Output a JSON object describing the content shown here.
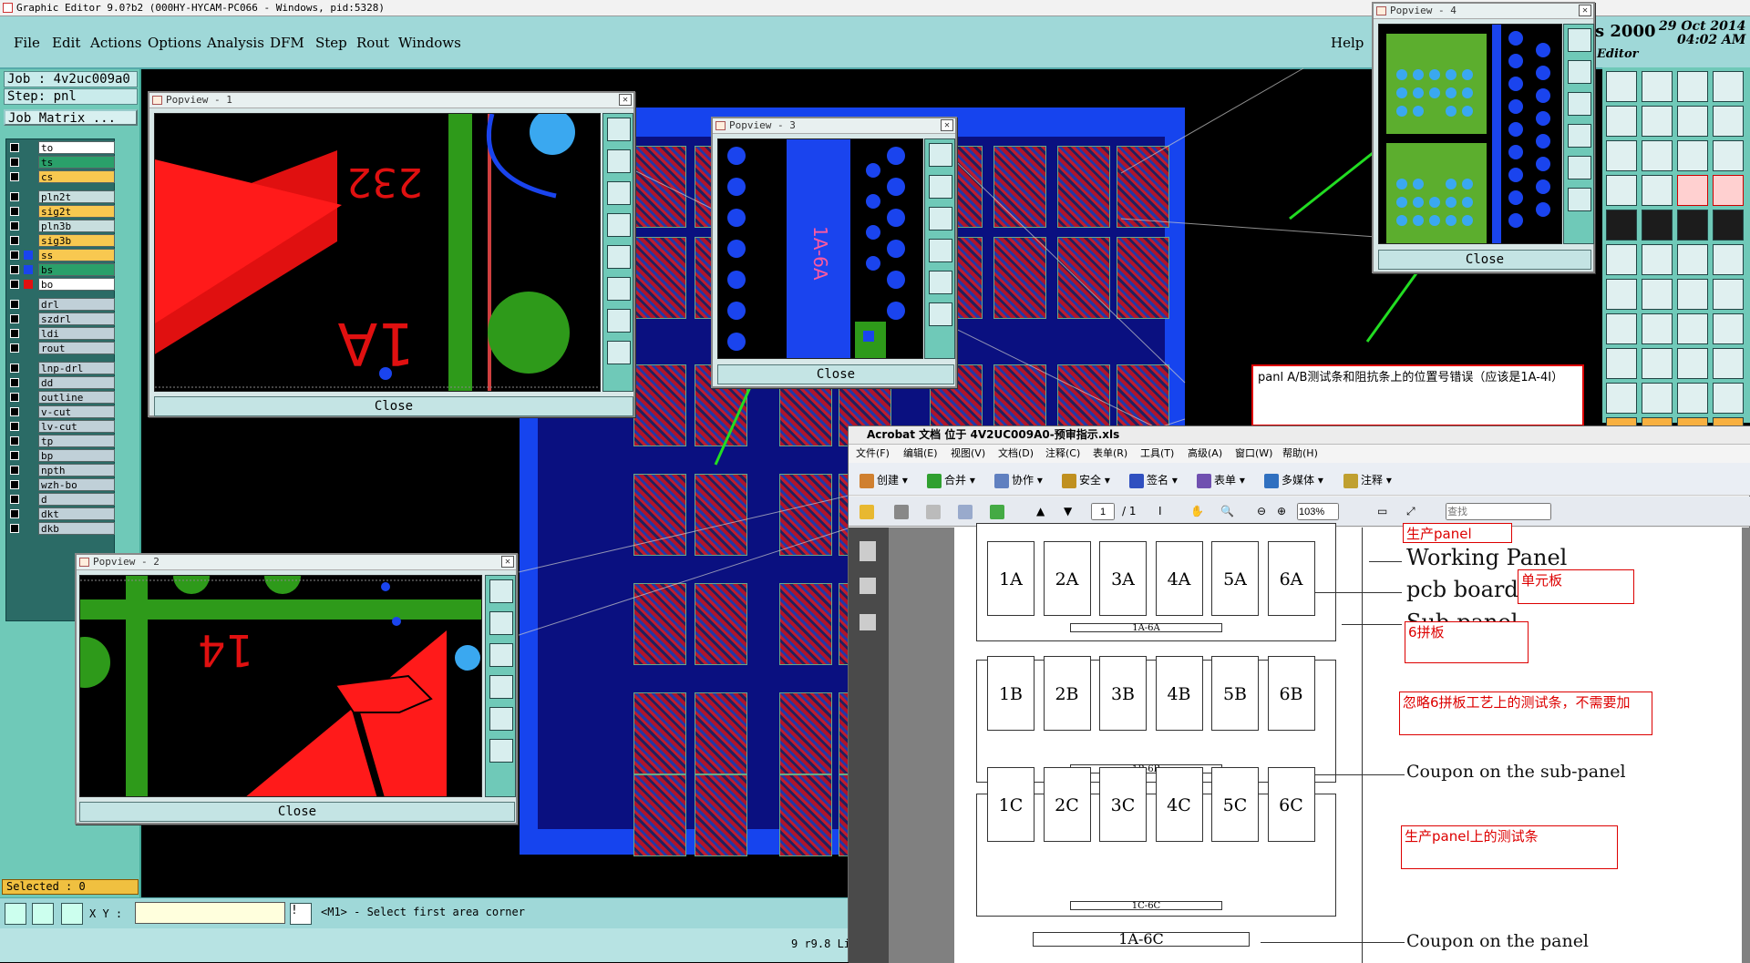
{
  "window": {
    "title": "Graphic Editor 9.0?b2 (000HY-HYCAM-PC066 - Windows, pid:5328)"
  },
  "menu": [
    "File",
    "Edit",
    "Actions",
    "Options",
    "Analysis",
    "DFM",
    "Step",
    "Rout",
    "Windows"
  ],
  "help": "Help",
  "header": {
    "title_fragment": "s 2000",
    "date": "29 Oct 2014",
    "time": "04:02 AM",
    "editor": "Editor"
  },
  "job": {
    "job_label": "Job : 4v2uc009a0",
    "step_label": "Step: pnl",
    "matrix_button": "Job Matrix ..."
  },
  "layers": [
    {
      "name": "to",
      "color": "#ffffff"
    },
    {
      "name": "ts",
      "color": "#2aa06a"
    },
    {
      "name": "cs",
      "color": "#f8c850"
    },
    {
      "name": "pln2t",
      "color": "#c8dede"
    },
    {
      "name": "sig2t",
      "color": "#f8c850"
    },
    {
      "name": "pln3b",
      "color": "#c8dede"
    },
    {
      "name": "sig3b",
      "color": "#f8c850"
    },
    {
      "name": "ss",
      "color": "#f8c850"
    },
    {
      "name": "bs",
      "color": "#2aa06a"
    },
    {
      "name": "bo",
      "color": "#ffffff"
    },
    {
      "name": "drl",
      "color": "#c0d0d8"
    },
    {
      "name": "szdrl",
      "color": "#c0d0d8"
    },
    {
      "name": "ldi",
      "color": "#c0d0d8"
    },
    {
      "name": "rout",
      "color": "#c0d0d8"
    },
    {
      "name": "lnp-drl",
      "color": "#c0d0d8"
    },
    {
      "name": "dd",
      "color": "#c0d0d8"
    },
    {
      "name": "outline",
      "color": "#c0d0d8"
    },
    {
      "name": "v-cut",
      "color": "#c0d0d8"
    },
    {
      "name": "lv-cut",
      "color": "#c0d0d8"
    },
    {
      "name": "tp",
      "color": "#c0d0d8"
    },
    {
      "name": "bp",
      "color": "#c0d0d8"
    },
    {
      "name": "npth",
      "color": "#c0d0d8"
    },
    {
      "name": "wzh-bo",
      "color": "#c0d0d8"
    },
    {
      "name": "d",
      "color": "#c0d0d8"
    },
    {
      "name": "dkt",
      "color": "#c0d0d8"
    },
    {
      "name": "dkb",
      "color": "#c0d0d8"
    }
  ],
  "status": {
    "selected": "Selected : 0",
    "xy_label": "X Y :",
    "hint": "<M1> - Select first area corner",
    "version": "9 r9.8 Li"
  },
  "popviews": {
    "p1": {
      "title": "Popview - 1",
      "close": "Close",
      "label_a": "1A",
      "label_b": "232"
    },
    "p2": {
      "title": "Popview - 2",
      "close": "Close",
      "label_a": "14"
    },
    "p3": {
      "title": "Popview - 3",
      "close": "Close",
      "label_a": "1A-6A"
    },
    "p4": {
      "title": "Popview - 4",
      "close": "Close"
    }
  },
  "annotation": "panl A/B测试条和阻抗条上的位置号错误（应该是1A-4I）",
  "acrobat": {
    "title": "Acrobat 文档 位于 4V2UC009A0-预审指示.xls",
    "menu": [
      "文件(F)",
      "编辑(E)",
      "视图(V)",
      "文档(D)",
      "注释(C)",
      "表单(R)",
      "工具(T)",
      "高级(A)",
      "窗口(W)",
      "帮助(H)"
    ],
    "toolbar": [
      "创建",
      "合并",
      "协作",
      "安全",
      "签名",
      "表单",
      "多媒体",
      "注释"
    ],
    "page_current": "1",
    "page_total": "/ 1",
    "zoom": "103%",
    "search_placeholder": "查找"
  },
  "doc": {
    "row_a": [
      "1A",
      "2A",
      "3A",
      "4A",
      "5A",
      "6A"
    ],
    "row_b": [
      "1B",
      "2B",
      "3B",
      "4B",
      "5B",
      "6B"
    ],
    "row_c": [
      "1C",
      "2C",
      "3C",
      "4C",
      "5C",
      "6C"
    ],
    "bar_a": "1A-6A",
    "bar_b": "1B-6B",
    "bar_c": "1C-6C",
    "bar_panel": "1A-6C",
    "working_panel": "Working Panel",
    "pcb_board": "pcb board",
    "sub_panel": "Sub-panel",
    "coupon_sub": "Coupon on the sub-panel",
    "coupon_panel": "Coupon on the panel",
    "note_top": "生产panel",
    "note_unit": "单元板",
    "note_six": "6拼板",
    "note_ignore": "忽略6拼板工艺上的测试条，不需要加",
    "note_prod": "生产panel上的测试条"
  }
}
